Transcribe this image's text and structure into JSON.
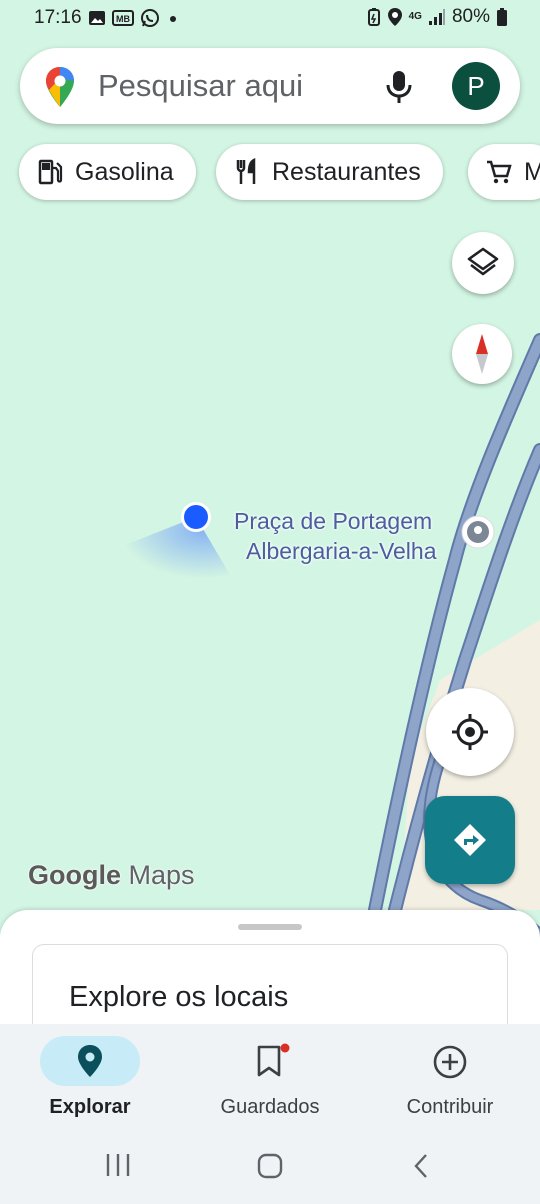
{
  "status_bar": {
    "time": "17:16",
    "battery": "80%",
    "network": "4G",
    "icons_left": [
      "gallery-icon",
      "mb-icon",
      "whatsapp-icon",
      "dot-icon"
    ],
    "icons_right": [
      "battery-saver-icon",
      "location-icon",
      "signal-icon",
      "battery-icon"
    ]
  },
  "search": {
    "placeholder": "Pesquisar aqui",
    "avatar_letter": "P",
    "icons": [
      "google-maps-pin-icon",
      "microphone-icon"
    ]
  },
  "chips": [
    {
      "label": "Gasolina",
      "icon": "gas-station-icon"
    },
    {
      "label": "Restaurantes",
      "icon": "fork-knife-icon"
    },
    {
      "label": "M",
      "icon": "shopping-cart-icon"
    }
  ],
  "map": {
    "place_name_line1": "Praça de Portagem",
    "place_name_line2": "Albergaria-a-Velha",
    "logo_google": "Google",
    "logo_maps": "Maps",
    "colors": {
      "land": "#d3f5e3",
      "road": "#8ea4c8",
      "user_dot": "#1a5cff",
      "accent": "#137d8a"
    }
  },
  "sheet": {
    "title": "Explore os locais"
  },
  "bottom_nav": [
    {
      "label": "Explorar",
      "icon": "explore-pin-icon",
      "active": true
    },
    {
      "label": "Guardados",
      "icon": "bookmark-icon",
      "active": false
    },
    {
      "label": "Contribuir",
      "icon": "add-circle-icon",
      "active": false
    }
  ]
}
